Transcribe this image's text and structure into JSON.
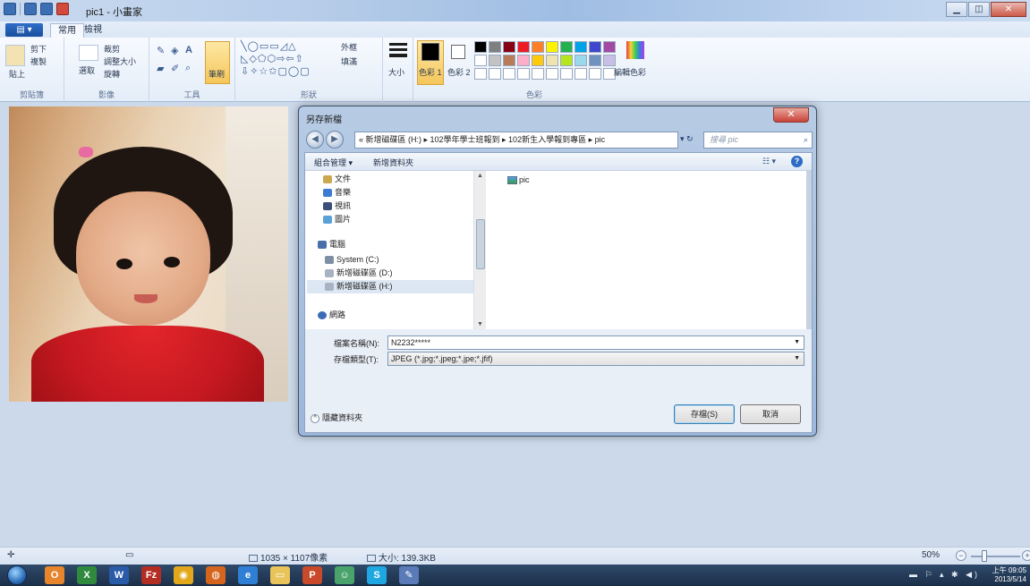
{
  "window": {
    "title": "pic1 - 小畫家",
    "file_tab": "▤ ▾",
    "tabs": [
      "常用",
      "檢視"
    ]
  },
  "ribbon": {
    "clipboard": {
      "paste": "貼上",
      "cut": "剪下",
      "copy": "複製",
      "label": "剪貼簿"
    },
    "image": {
      "select": "選取",
      "crop": "裁剪",
      "resize": "調整大小",
      "rotate": "旋轉",
      "label": "影像"
    },
    "tools": {
      "label": "工具",
      "brushes": "筆刷"
    },
    "shapes": {
      "outline": "外框",
      "fill": "填滿",
      "label": "形狀"
    },
    "size": "大小",
    "colors": {
      "color1": "色彩 1",
      "color2": "色彩 2",
      "edit": "編輯色彩",
      "label": "色彩"
    },
    "palette_top": [
      "#000000",
      "#7f7f7f",
      "#880015",
      "#ed1c24",
      "#ff7f27",
      "#fff200",
      "#22b14c",
      "#00a2e8",
      "#3f48cc",
      "#a349a4"
    ],
    "palette_mid": [
      "#ffffff",
      "#c3c3c3",
      "#b97a57",
      "#ffaec9",
      "#ffc90e",
      "#efe4b0",
      "#b5e61d",
      "#99d9ea",
      "#7092be",
      "#c8bfe7"
    ]
  },
  "dialog": {
    "title": "另存新檔",
    "close": "✕",
    "back": "◀",
    "forward": "▶",
    "address": "« 新增磁碟區 (H:) ▸ 102學年學士班報到 ▸ 102新生入學報到專區 ▸ pic",
    "refresh": "▾ ↻",
    "search_placeholder": "搜尋 pic",
    "search_icon": "⌕",
    "organize": "組合管理 ▾",
    "new_folder": "新增資料夾",
    "view": "☷ ▾",
    "help": "?",
    "nav_items": [
      {
        "label": "文件"
      },
      {
        "label": "音樂"
      },
      {
        "label": "視訊"
      },
      {
        "label": "圖片"
      },
      {
        "label": "電腦"
      },
      {
        "label": "System (C:)"
      },
      {
        "label": "新增磁碟區 (D:)"
      },
      {
        "label": "新增磁碟區 (H:)"
      },
      {
        "label": "網路"
      }
    ],
    "files": [
      {
        "name": "pic"
      }
    ],
    "filename_label": "檔案名稱(N):",
    "filename_value": "N2232*****",
    "filetype_label": "存檔類型(T):",
    "filetype_value": "JPEG (*.jpg;*.jpeg;*.jpe;*.jfif)",
    "hide_folders": "隱藏資料夾",
    "save": "存檔(S)",
    "cancel": "取消"
  },
  "statusbar": {
    "dimensions": "1035 × 1107像素",
    "size": "大小: 139.3KB",
    "zoom": "50%"
  },
  "taskbar": {
    "time": "上午 09:05",
    "date": "2013/5/14",
    "apps": [
      {
        "name": "outlook",
        "color": "#e6852b",
        "glyph": "O"
      },
      {
        "name": "excel",
        "color": "#2f8a3e",
        "glyph": "X"
      },
      {
        "name": "word",
        "color": "#2a5ba8",
        "glyph": "W"
      },
      {
        "name": "filezilla",
        "color": "#b32d22",
        "glyph": "Fz"
      },
      {
        "name": "chrome",
        "color": "#e3a71c",
        "glyph": "◉"
      },
      {
        "name": "firefox",
        "color": "#d5651d",
        "glyph": "◍"
      },
      {
        "name": "ie",
        "color": "#2f7fd4",
        "glyph": "e"
      },
      {
        "name": "explorer",
        "color": "#e8c45a",
        "glyph": "▭"
      },
      {
        "name": "powerpoint",
        "color": "#c84a2a",
        "glyph": "P"
      },
      {
        "name": "messenger",
        "color": "#4aa36b",
        "glyph": "☺"
      },
      {
        "name": "skype",
        "color": "#1ea7e0",
        "glyph": "S"
      },
      {
        "name": "paint",
        "color": "#5b7bb8",
        "glyph": "✎"
      }
    ]
  }
}
